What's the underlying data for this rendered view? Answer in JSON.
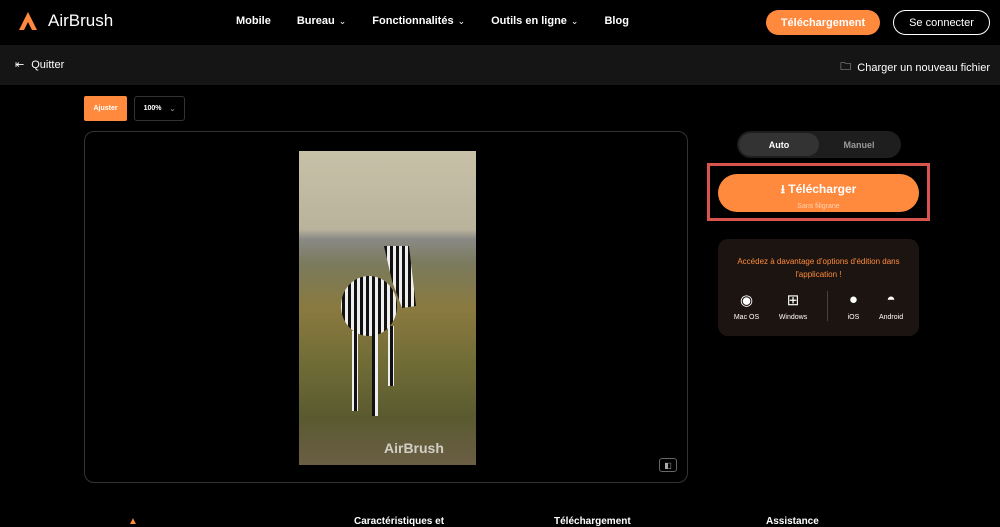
{
  "brand": {
    "name": "AirBrush",
    "accent": "#ff8a3d"
  },
  "nav": {
    "items": [
      {
        "label": "Mobile",
        "dropdown": false
      },
      {
        "label": "Bureau",
        "dropdown": true
      },
      {
        "label": "Fonctionnalités",
        "dropdown": true
      },
      {
        "label": "Outils en ligne",
        "dropdown": true
      },
      {
        "label": "Blog",
        "dropdown": false
      }
    ],
    "download": "Téléchargement",
    "login": "Se connecter"
  },
  "toolbar": {
    "quit": "Quitter",
    "upload": "Charger un nouveau fichier"
  },
  "editor": {
    "adjust": "Ajuster",
    "zoom": "100%",
    "watermark": "AirBrush"
  },
  "panel": {
    "modes": [
      "Auto",
      "Manuel"
    ],
    "active_mode": "Auto",
    "download": "Télécharger",
    "download_sub": "Sans filigrane",
    "promo": "Accédez à davantage d'options d'édition dans l'application !",
    "platforms": [
      "Mac OS",
      "Windows",
      "iOS",
      "Android"
    ]
  },
  "footer": {
    "cols": [
      "Caractéristiques et",
      "Téléchargement",
      "Assistance"
    ]
  }
}
